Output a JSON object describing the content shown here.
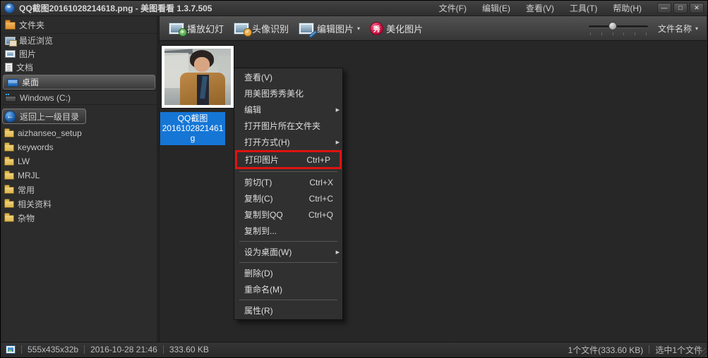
{
  "colors": {
    "red": "#de1310",
    "blue": "#1576d6"
  },
  "title_bar": {
    "title": "QQ截图20161028214618.png - 美图看看 1.3.7.505",
    "menu_items": [
      "文件(F)",
      "编辑(E)",
      "查看(V)",
      "工具(T)",
      "帮助(H)"
    ],
    "controls": {
      "minimize": "—",
      "maximize": "□",
      "close": "✕"
    }
  },
  "toolbar": {
    "buttons": [
      "播放幻灯",
      "头像识别",
      "编辑图片",
      "美化图片"
    ],
    "beautify_glyph": "秀",
    "edit_dropdown_arrow": "▾",
    "sort_label": "文件名称",
    "sort_arrow": "▾"
  },
  "sidebar": {
    "header": "文件夹",
    "nav_items": [
      "最近浏览",
      "图片",
      "文档",
      "桌面",
      "Windows (C:)"
    ],
    "back_button": "返回上一级目录",
    "back_glyph": "←",
    "folders": [
      "aizhanseo_setup",
      "keywords",
      "LW",
      "MRJL",
      "常用",
      "相关资料",
      "杂物"
    ]
  },
  "main": {
    "thumbnail_label_lines": [
      "QQ截图",
      "2016102821461",
      "g"
    ]
  },
  "context_menu": {
    "items": [
      {
        "label": "查看(V)"
      },
      {
        "label": "用美图秀秀美化"
      },
      {
        "label": "编辑",
        "has_submenu": true
      },
      {
        "label": "打开图片所在文件夹"
      },
      {
        "label": "打开方式(H)",
        "has_submenu": true
      },
      {
        "label": "打印图片",
        "shortcut": "Ctrl+P",
        "highlighted": true
      },
      {
        "label": "剪切(T)",
        "shortcut": "Ctrl+X"
      },
      {
        "label": "复制(C)",
        "shortcut": "Ctrl+C"
      },
      {
        "label": "复制到QQ",
        "shortcut": "Ctrl+Q"
      },
      {
        "label": "复制到..."
      },
      {
        "label": "设为桌面(W)",
        "has_submenu": true
      },
      {
        "label": "删除(D)"
      },
      {
        "label": "重命名(M)"
      },
      {
        "label": "属性(R)"
      }
    ],
    "submenu_arrow": "▶"
  },
  "status_bar": {
    "left_items": [
      "555x435x32b",
      "2016-10-28 21:46",
      "333.60 KB"
    ],
    "right_items": [
      "1个文件(333.60 KB)",
      "选中1个文件"
    ]
  }
}
